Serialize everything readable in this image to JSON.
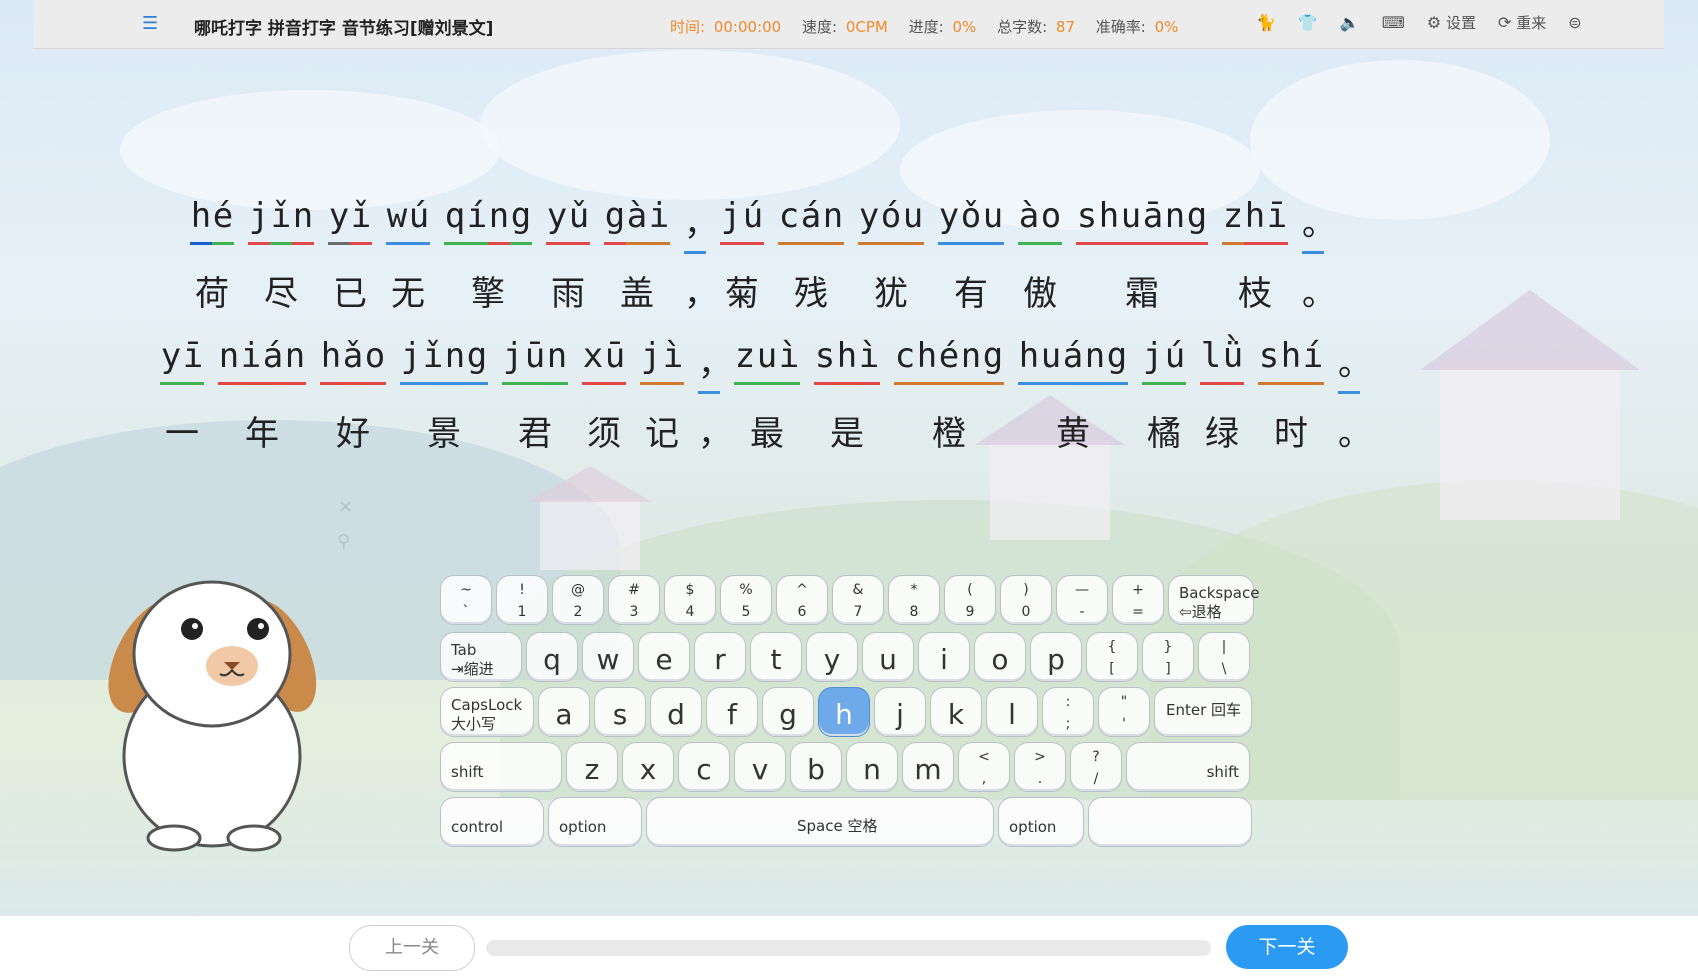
{
  "app": {
    "title": "哪吒打字 拼音打字 音节练习[赠刘景文]"
  },
  "stats": {
    "time_label": "时间:",
    "time_value": "00:00:00",
    "speed_label": "速度:",
    "speed_value": "0CPM",
    "progress_label": "进度:",
    "progress_value": "0%",
    "total_label": "总字数:",
    "total_value": "87",
    "accuracy_label": "准确率:",
    "accuracy_value": "0%"
  },
  "tools": {
    "settings_label": "设置",
    "restart_label": "重来"
  },
  "icons": {
    "menu": "menu-icon",
    "skin": "cat-icon",
    "shirt": "shirt-icon",
    "sound": "speaker-icon",
    "keyboard": "keyboard-icon",
    "settings": "gear-icon",
    "restart": "refresh-icon",
    "share": "share-icon"
  },
  "lines": [
    {
      "syllables": [
        {
          "py": "hé",
          "han": "荷",
          "colors": [
            "#1a5fcf",
            "#3fb34f"
          ]
        },
        {
          "py": "jǐn",
          "han": "尽",
          "colors": [
            "#e2484a",
            "#3fb34f",
            "#e2484a"
          ]
        },
        {
          "py": "yǐ",
          "han": "已",
          "colors": [
            "#6b6b6b",
            "#e2484a"
          ]
        },
        {
          "py": "wú",
          "han": "无",
          "colors": [
            "#3a8fe0",
            "#3a8fe0"
          ]
        },
        {
          "py": "qíng",
          "han": "擎",
          "colors": [
            "#3fb34f",
            "#3fb34f",
            "#e2484a",
            "#3fb34f"
          ]
        },
        {
          "py": "yǔ",
          "han": "雨",
          "colors": [
            "#e2484a",
            "#e2484a"
          ]
        },
        {
          "py": "gài",
          "han": "盖",
          "colors": [
            "#e2484a",
            "#d07a2d",
            "#d07a2d"
          ]
        },
        {
          "py": "，",
          "han": "，",
          "colors": [
            "#3a8fe0"
          ]
        },
        {
          "py": "jú",
          "han": "菊",
          "colors": [
            "#e2484a",
            "#e2484a"
          ]
        },
        {
          "py": "cán",
          "han": "残",
          "colors": [
            "#d07a2d",
            "#d07a2d",
            "#d07a2d"
          ]
        },
        {
          "py": "yóu",
          "han": "犹",
          "colors": [
            "#d07a2d",
            "#d07a2d",
            "#d07a2d"
          ]
        },
        {
          "py": "yǒu",
          "han": "有",
          "colors": [
            "#3a8fe0",
            "#3a8fe0",
            "#3a8fe0"
          ]
        },
        {
          "py": "ào",
          "han": "傲",
          "colors": [
            "#3fb34f",
            "#3fb34f"
          ]
        },
        {
          "py": "shuāng",
          "han": "霜",
          "colors": [
            "#e2484a",
            "#e2484a",
            "#e2484a",
            "#e2484a",
            "#e2484a",
            "#e2484a"
          ]
        },
        {
          "py": "zhī",
          "han": "枝",
          "colors": [
            "#d07a2d",
            "#e2484a",
            "#e2484a"
          ]
        },
        {
          "py": "。",
          "han": "。",
          "colors": [
            "#3a8fe0"
          ]
        }
      ]
    },
    {
      "syllables": [
        {
          "py": "yī",
          "han": "一",
          "colors": [
            "#3fb34f",
            "#3fb34f"
          ]
        },
        {
          "py": "nián",
          "han": "年",
          "colors": [
            "#e2484a",
            "#e2484a",
            "#e2484a",
            "#e2484a"
          ]
        },
        {
          "py": "hǎo",
          "han": "好",
          "colors": [
            "#e2484a",
            "#e2484a",
            "#e2484a"
          ]
        },
        {
          "py": "jǐng",
          "han": "景",
          "colors": [
            "#3a8fe0",
            "#3a8fe0",
            "#3a8fe0",
            "#3a8fe0"
          ]
        },
        {
          "py": "jūn",
          "han": "君",
          "colors": [
            "#3fb34f",
            "#3fb34f",
            "#3fb34f"
          ]
        },
        {
          "py": "xū",
          "han": "须",
          "colors": [
            "#e2484a",
            "#e2484a"
          ]
        },
        {
          "py": "jì",
          "han": "记",
          "colors": [
            "#d07a2d",
            "#d07a2d"
          ]
        },
        {
          "py": "，",
          "han": "，",
          "colors": [
            "#3a8fe0"
          ]
        },
        {
          "py": "zuì",
          "han": "最",
          "colors": [
            "#3fb34f",
            "#3fb34f",
            "#3fb34f"
          ]
        },
        {
          "py": "shì",
          "han": "是",
          "colors": [
            "#e2484a",
            "#e2484a",
            "#e2484a"
          ]
        },
        {
          "py": "chéng",
          "han": "橙",
          "colors": [
            "#d07a2d",
            "#d07a2d",
            "#d07a2d",
            "#d07a2d",
            "#d07a2d"
          ]
        },
        {
          "py": "huáng",
          "han": "黄",
          "colors": [
            "#3a8fe0",
            "#3a8fe0",
            "#3a8fe0",
            "#3a8fe0",
            "#3a8fe0"
          ]
        },
        {
          "py": "jú",
          "han": "橘",
          "colors": [
            "#3fb34f",
            "#3fb34f"
          ]
        },
        {
          "py": "lǜ",
          "han": "绿",
          "colors": [
            "#e2484a",
            "#e2484a"
          ]
        },
        {
          "py": "shí",
          "han": "时",
          "colors": [
            "#d07a2d",
            "#d07a2d",
            "#d07a2d"
          ]
        },
        {
          "py": "。",
          "han": "。",
          "colors": [
            "#3a8fe0"
          ]
        }
      ]
    }
  ],
  "keyboard": {
    "active_key": "h",
    "rows": [
      [
        {
          "top": "~",
          "bot": "`"
        },
        {
          "top": "!",
          "bot": "1"
        },
        {
          "top": "@",
          "bot": "2"
        },
        {
          "top": "#",
          "bot": "3"
        },
        {
          "top": "$",
          "bot": "4"
        },
        {
          "top": "%",
          "bot": "5"
        },
        {
          "top": "^",
          "bot": "6"
        },
        {
          "top": "&",
          "bot": "7"
        },
        {
          "top": "*",
          "bot": "8"
        },
        {
          "top": "(",
          "bot": "9"
        },
        {
          "top": ")",
          "bot": "0"
        },
        {
          "top": "—",
          "bot": "-"
        },
        {
          "top": "+",
          "bot": "="
        },
        {
          "label": "Backspace\n⇦退格",
          "wide": "backspace"
        }
      ],
      [
        {
          "label": "Tab\n⇥缩进",
          "wide": "tab"
        },
        {
          "big": "q"
        },
        {
          "big": "w"
        },
        {
          "big": "e"
        },
        {
          "big": "r"
        },
        {
          "big": "t"
        },
        {
          "big": "y"
        },
        {
          "big": "u"
        },
        {
          "big": "i"
        },
        {
          "big": "o"
        },
        {
          "big": "p"
        },
        {
          "top": "{",
          "bot": "["
        },
        {
          "top": "}",
          "bot": "]"
        },
        {
          "top": "|",
          "bot": "\\"
        }
      ],
      [
        {
          "label": "CapsLock\n大小写",
          "wide": "caps"
        },
        {
          "big": "a"
        },
        {
          "big": "s"
        },
        {
          "big": "d"
        },
        {
          "big": "f"
        },
        {
          "big": "g"
        },
        {
          "big": "h"
        },
        {
          "big": "j"
        },
        {
          "big": "k"
        },
        {
          "big": "l"
        },
        {
          "top": ":",
          "bot": ";"
        },
        {
          "top": "\"",
          "bot": "'"
        },
        {
          "label": "Enter 回车",
          "wide": "enter"
        }
      ],
      [
        {
          "label": "shift",
          "wide": "lshift"
        },
        {
          "big": "z"
        },
        {
          "big": "x"
        },
        {
          "big": "c"
        },
        {
          "big": "v"
        },
        {
          "big": "b"
        },
        {
          "big": "n"
        },
        {
          "big": "m"
        },
        {
          "top": "<",
          "bot": ","
        },
        {
          "top": ">",
          "bot": "."
        },
        {
          "top": "?",
          "bot": "/"
        },
        {
          "label": "shift",
          "wide": "rshift"
        }
      ],
      [
        {
          "label": "control",
          "wide": "control"
        },
        {
          "label": "option",
          "wide": "option"
        },
        {
          "label": "Space 空格",
          "wide": "space"
        },
        {
          "label": "option",
          "wide": "option2"
        },
        {
          "label": "",
          "wide": "blank"
        }
      ]
    ]
  },
  "bottom": {
    "prev_label": "上一关",
    "next_label": "下一关",
    "progress_fraction": 0
  }
}
